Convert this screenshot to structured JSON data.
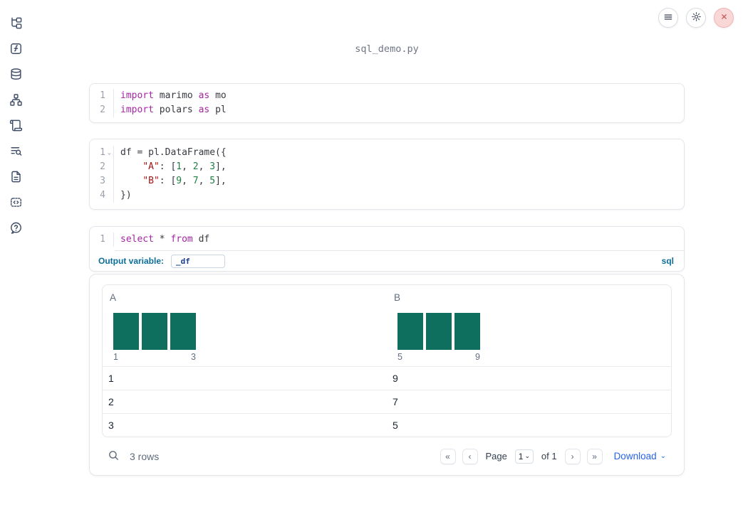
{
  "app": {
    "title": "sql_demo.py"
  },
  "topbar": {
    "buttons": [
      {
        "icon": "hamburger-menu-icon"
      },
      {
        "icon": "gear-icon"
      },
      {
        "icon": "close-icon"
      }
    ]
  },
  "sidebar": {
    "items": [
      "file-tree",
      "function-square",
      "database",
      "sitemap",
      "scroll",
      "list-search",
      "file-text",
      "code-snippet",
      "help"
    ]
  },
  "icons": {
    "fold": "⌄",
    "select_caret": "⌄",
    "download_caret": "⌄",
    "pager_first": "«",
    "pager_prev": "‹",
    "pager_next": "›",
    "pager_last": "»"
  },
  "cells": [
    {
      "type": "python",
      "lines": [
        {
          "num": "1",
          "tokens": [
            {
              "t": "import",
              "s": "kw"
            },
            {
              "t": " marimo ",
              "s": "d"
            },
            {
              "t": "as",
              "s": "kw"
            },
            {
              "t": " mo",
              "s": "d"
            }
          ]
        },
        {
          "num": "2",
          "tokens": [
            {
              "t": "import",
              "s": "kw"
            },
            {
              "t": " polars ",
              "s": "d"
            },
            {
              "t": "as",
              "s": "kw"
            },
            {
              "t": " pl",
              "s": "d"
            }
          ]
        }
      ]
    },
    {
      "type": "python",
      "lines": [
        {
          "num": "1",
          "fold": true,
          "tokens": [
            {
              "t": "df = pl.DataFrame({",
              "s": "d"
            }
          ]
        },
        {
          "num": "2",
          "tokens": [
            {
              "t": "    ",
              "s": "d"
            },
            {
              "t": "\"A\"",
              "s": "str"
            },
            {
              "t": ": [",
              "s": "d"
            },
            {
              "t": "1",
              "s": "num"
            },
            {
              "t": ", ",
              "s": "d"
            },
            {
              "t": "2",
              "s": "num"
            },
            {
              "t": ", ",
              "s": "d"
            },
            {
              "t": "3",
              "s": "num"
            },
            {
              "t": "],",
              "s": "d"
            }
          ]
        },
        {
          "num": "3",
          "tokens": [
            {
              "t": "    ",
              "s": "d"
            },
            {
              "t": "\"B\"",
              "s": "str"
            },
            {
              "t": ": [",
              "s": "d"
            },
            {
              "t": "9",
              "s": "num"
            },
            {
              "t": ", ",
              "s": "d"
            },
            {
              "t": "7",
              "s": "num"
            },
            {
              "t": ", ",
              "s": "d"
            },
            {
              "t": "5",
              "s": "num"
            },
            {
              "t": "],",
              "s": "d"
            }
          ]
        },
        {
          "num": "4",
          "tokens": [
            {
              "t": "})",
              "s": "d"
            }
          ]
        }
      ]
    },
    {
      "type": "sql",
      "lines": [
        {
          "num": "1",
          "tokens": [
            {
              "t": "select",
              "s": "kw"
            },
            {
              "t": " * ",
              "s": "d"
            },
            {
              "t": "from",
              "s": "kw"
            },
            {
              "t": " df",
              "s": "d"
            }
          ]
        }
      ]
    }
  ],
  "sql_cell": {
    "output_variable_label": "Output variable:",
    "output_variable_value": "_df",
    "language_badge": "sql"
  },
  "table": {
    "columns": [
      {
        "name": "A",
        "hist": {
          "values": [
            1,
            1,
            1
          ],
          "min": "1",
          "max": "3"
        }
      },
      {
        "name": "B",
        "hist": {
          "values": [
            1,
            1,
            1
          ],
          "min": "5",
          "max": "9"
        }
      }
    ],
    "rows": [
      [
        "1",
        "9"
      ],
      [
        "2",
        "7"
      ],
      [
        "3",
        "5"
      ]
    ],
    "footer": {
      "row_count": "3 rows",
      "page_label": "Page",
      "page_value": "1",
      "page_total": "of 1",
      "download_label": "Download"
    }
  },
  "colors": {
    "keyword": "#a626a4",
    "string": "#a31515",
    "number": "#1f7d45",
    "histogram_bar": "#0e6f5e",
    "accent_blue": "#2563eb",
    "sql_label_blue": "#0b6e99",
    "close_red": "#c4574f"
  }
}
